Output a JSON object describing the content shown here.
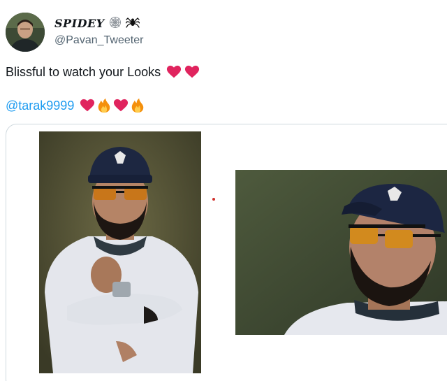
{
  "author": {
    "display_name": "SPIDEY",
    "handle": "@Pavan_Tweeter",
    "badges": [
      "spider-web-icon",
      "spider-icon"
    ]
  },
  "tweet": {
    "text": "Blissful to watch your Looks",
    "text_emojis": [
      "heart-icon",
      "heart-icon"
    ],
    "mention": "@tarak9999",
    "mention_emojis": [
      "heart-icon",
      "fire-icon",
      "heart-icon",
      "fire-icon"
    ]
  },
  "media": {
    "photos": [
      "photo-left",
      "photo-right"
    ]
  },
  "colors": {
    "link": "#1d9bf0",
    "heart": "#e0245e",
    "handle": "#536471",
    "border": "#cfd9de"
  }
}
